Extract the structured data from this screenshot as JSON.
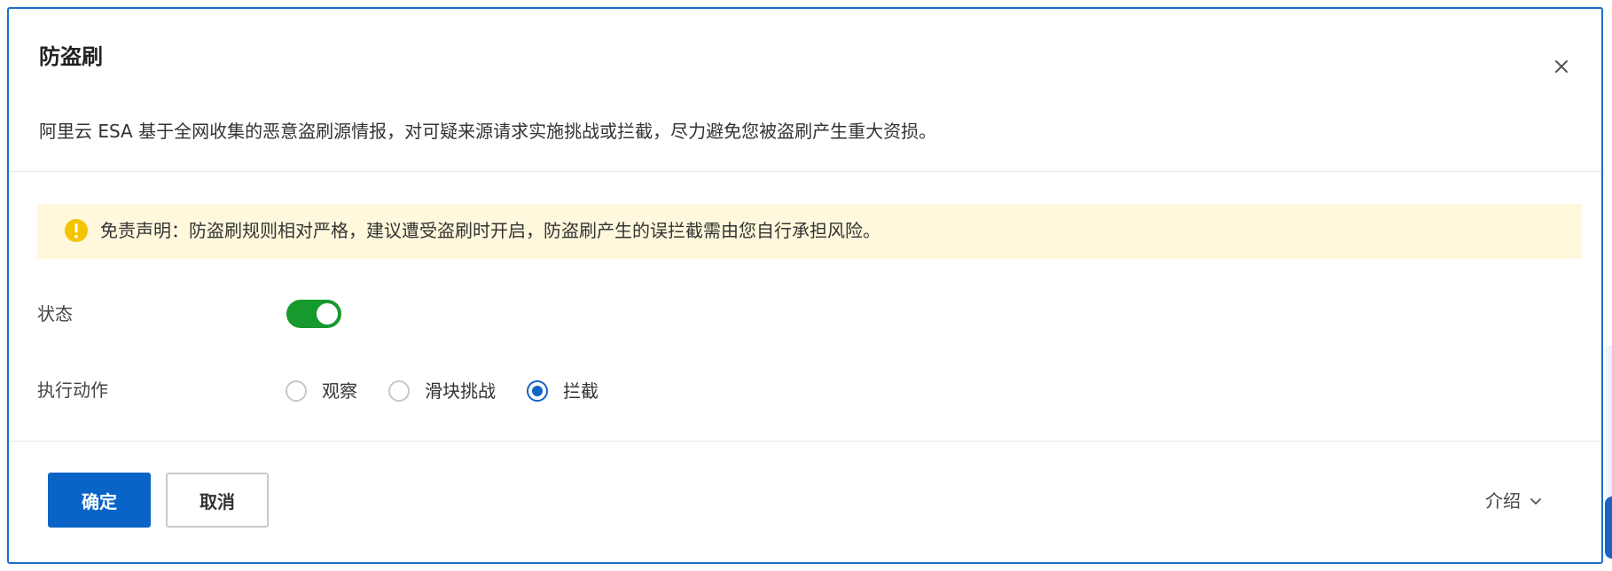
{
  "dialog": {
    "title": "防盗刷",
    "description": "阿里云 ESA 基于全网收集的恶意盗刷源情报，对可疑来源请求实施挑战或拦截，尽力避免您被盗刷产生重大资损。",
    "close_icon": "close-icon"
  },
  "warning": {
    "icon": "exclamation-circle-icon",
    "text": "免责声明：防盗刷规则相对严格，建议遭受盗刷时开启，防盗刷产生的误拦截需由您自行承担风险。",
    "background_color": "#fff8dc",
    "icon_color": "#f5c400"
  },
  "form": {
    "status": {
      "label": "状态",
      "enabled": true,
      "toggle_color": "#16992d"
    },
    "action": {
      "label": "执行动作",
      "options": [
        {
          "label": "观察",
          "checked": false
        },
        {
          "label": "滑块挑战",
          "checked": false
        },
        {
          "label": "拦截",
          "checked": true
        }
      ],
      "accent_color": "#1264c8"
    }
  },
  "footer": {
    "confirm_label": "确定",
    "cancel_label": "取消",
    "intro_label": "介绍",
    "primary_color": "#0a64c8"
  }
}
